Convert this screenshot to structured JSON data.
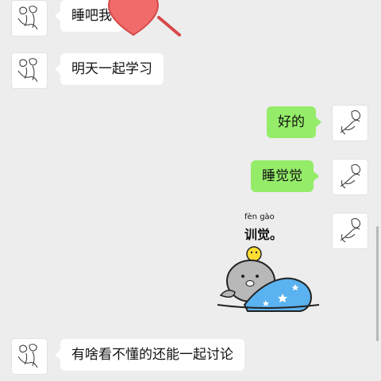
{
  "messages": [
    {
      "side": "left",
      "text": "睡吧我"
    },
    {
      "side": "left",
      "text": "明天一起学习"
    },
    {
      "side": "right",
      "text": "好的"
    },
    {
      "side": "right",
      "text": "睡觉觉"
    },
    {
      "side": "right",
      "sticker": {
        "pinyin": "fèn gào",
        "caption": "训觉。"
      }
    },
    {
      "side": "left",
      "text": "有啥看不懂的还能一起讨论"
    }
  ],
  "icons": {
    "heart": "heart-icon",
    "avatar": "sketch-avatar"
  },
  "colors": {
    "background": "#ededed",
    "bubble_left": "#ffffff",
    "bubble_right": "#95ec69",
    "heart": "#f26b6b",
    "blanket": "#5ab2f0"
  }
}
